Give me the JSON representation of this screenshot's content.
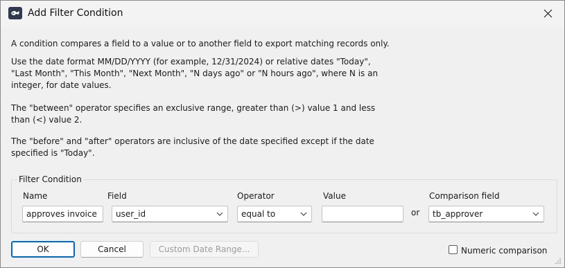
{
  "window": {
    "title": "Add Filter Condition"
  },
  "description": {
    "p1": "A condition compares a field to a value or to another field to export matching records only.",
    "p2_l1": "Use the date format MM/DD/YYYY (for example, 12/31/2024) or relative dates \"Today\",",
    "p2_l2": "\"Last Month\", \"This Month\", \"Next Month\", \"N days ago\" or \"N hours ago\", where N is an",
    "p2_l3": "integer, for date values.",
    "p3_l1": "The \"between\" operator specifies an exclusive range, greater than (>) value 1 and less",
    "p3_l2": "than (<) value 2.",
    "p4_l1": "The \"before\" and \"after\" operators are inclusive of the date specified except if the date",
    "p4_l2": "specified is \"Today\"."
  },
  "filter": {
    "group_title": "Filter Condition",
    "labels": {
      "name": "Name",
      "field": "Field",
      "operator": "Operator",
      "value": "Value",
      "comparison_field": "Comparison field"
    },
    "name_value": "approves invoice",
    "field_value": "user_id",
    "operator_value": "equal to",
    "value_value": "",
    "or_label": "or",
    "comparison_field_value": "tb_approver"
  },
  "buttons": {
    "ok": "OK",
    "cancel": "Cancel",
    "custom_date_range": "Custom Date Range..."
  },
  "numeric_comparison": {
    "label": "Numeric comparison",
    "checked": false
  }
}
